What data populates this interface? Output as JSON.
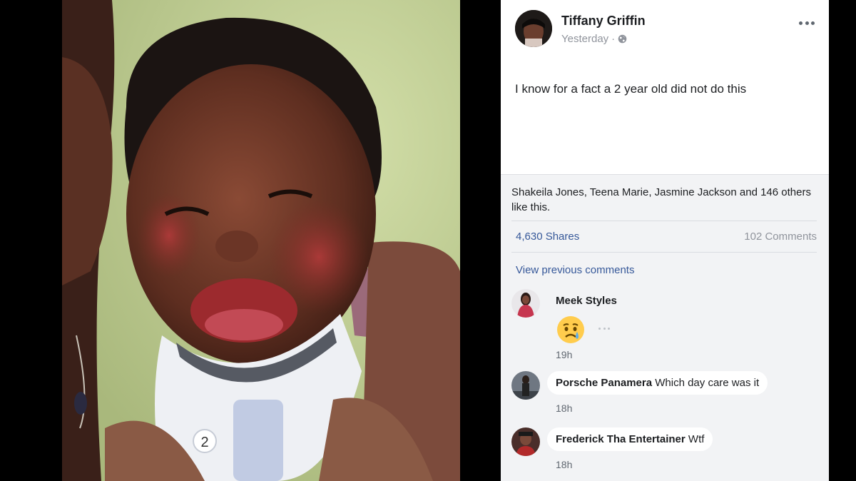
{
  "post": {
    "author": "Tiffany Griffin",
    "time": "Yesterday",
    "separator": "·",
    "text": "I know for a fact a 2 year old did not do this",
    "likes_summary": "Shakeila Jones, Teena Marie, Jasmine Jackson and 146 others like this.",
    "shares": "4,630 Shares",
    "comments_count": "102 Comments",
    "view_previous": "View previous comments"
  },
  "comments": [
    {
      "name": "Meek Styles",
      "text": "",
      "time": "19h",
      "emoji": "crying-face"
    },
    {
      "name": "Porsche Panamera",
      "text": "Which day care was it",
      "time": "18h"
    },
    {
      "name": "Frederick Tha Entertainer",
      "text": "Wtf",
      "time": "18h"
    }
  ],
  "photo": {
    "collar_number": "2"
  },
  "icons": {
    "privacy": "globe-icon",
    "menu": "more-icon"
  },
  "colors": {
    "link": "#365899",
    "meta": "#90949c",
    "footer_bg": "#f2f3f5"
  }
}
